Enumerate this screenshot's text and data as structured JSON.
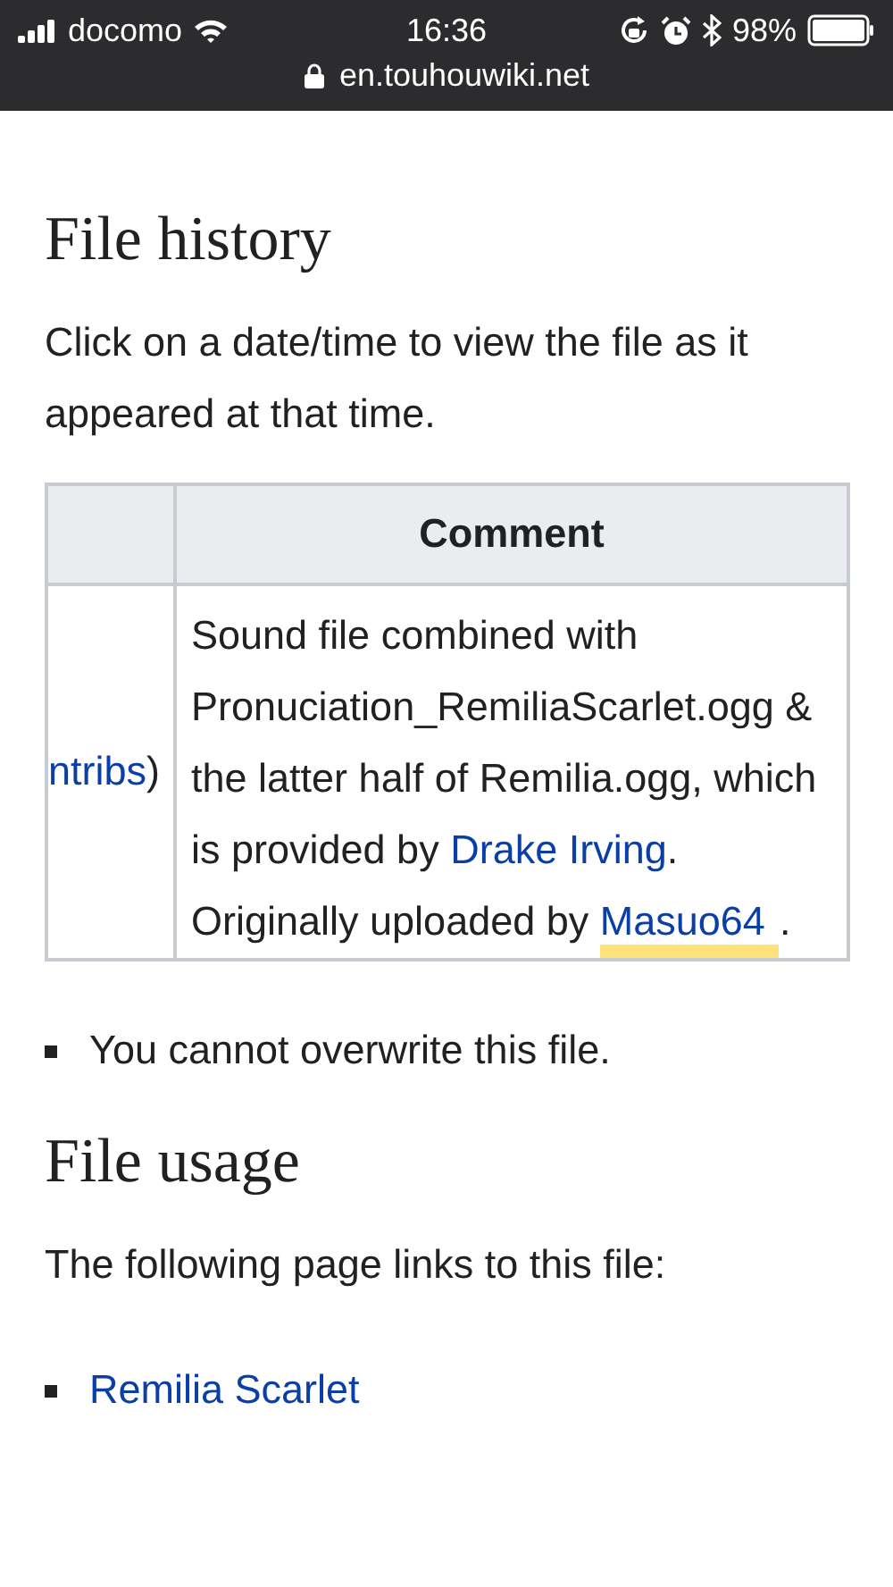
{
  "status_bar": {
    "carrier": "docomo",
    "time": "16:36",
    "battery": "98%",
    "url": "en.touhouwiki.net"
  },
  "sections": [
    {
      "heading": "File history",
      "intro": "Click on a date/time to view the file as it appeared at that time.",
      "table": {
        "columns": [
          "",
          "Comment"
        ],
        "rows": [
          {
            "cells": [
              [
                {
                  "kind": "link",
                  "text": "ntribs"
                },
                {
                  "kind": "text",
                  "text": ")"
                }
              ],
              [
                {
                  "kind": "text",
                  "text": "Sound file combined with Pronuciation_RemiliaScarlet.ogg & the latter half of Remilia.ogg, which is provided by "
                },
                {
                  "kind": "link",
                  "text": "Drake Irving"
                },
                {
                  "kind": "text",
                  "text": ". Originally uploaded by "
                },
                {
                  "kind": "link",
                  "text": "Masuo64",
                  "highlighted": true
                },
                {
                  "kind": "text",
                  "text": "."
                }
              ]
            ]
          }
        ]
      },
      "bullets": [
        {
          "kind": "text",
          "text": "You cannot overwrite this file."
        }
      ]
    },
    {
      "heading": "File usage",
      "intro": "The following page links to this file:",
      "bullets": [
        {
          "kind": "link",
          "text": "Remilia Scarlet"
        }
      ]
    }
  ]
}
